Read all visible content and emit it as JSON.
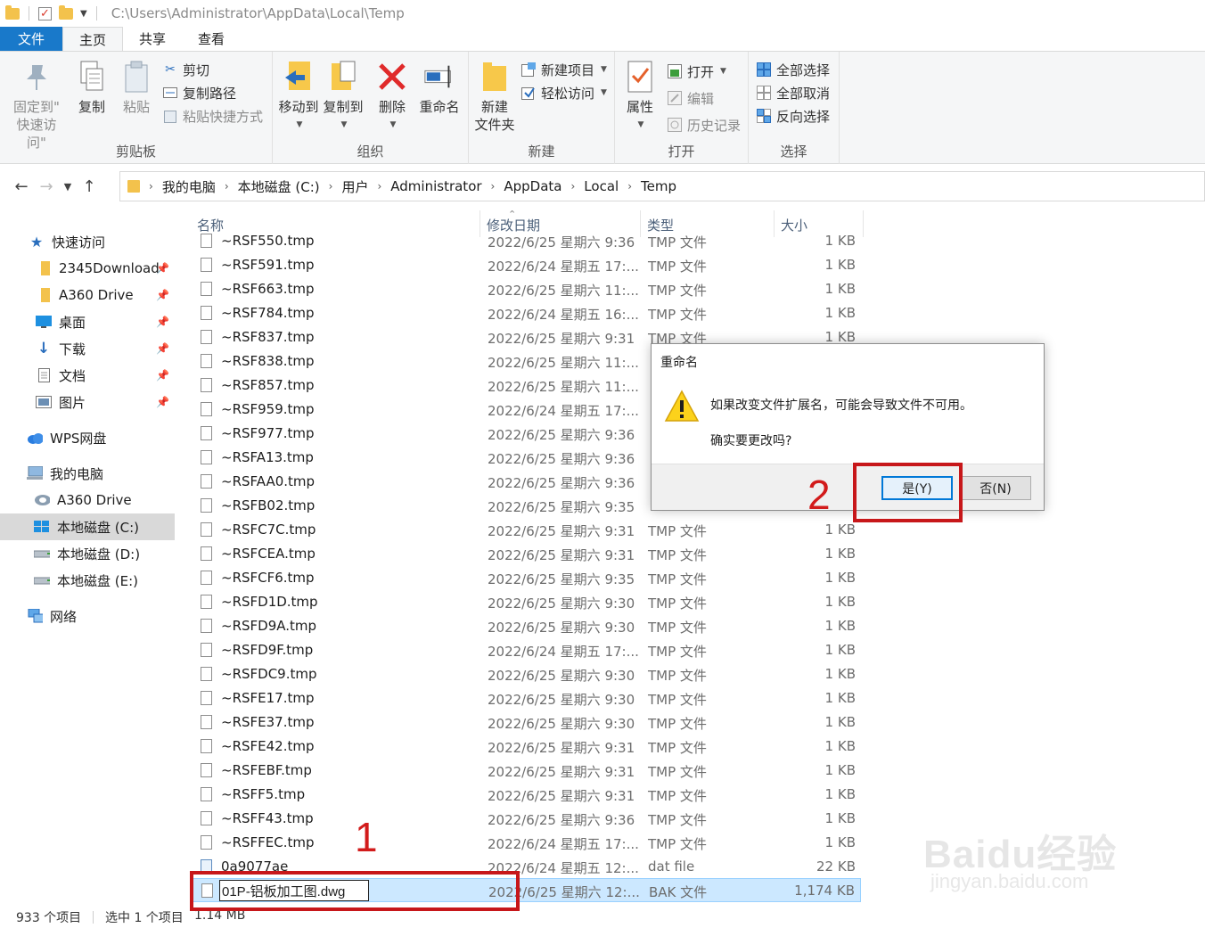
{
  "titlebar": {
    "path": "C:\\Users\\Administrator\\AppData\\Local\\Temp"
  },
  "tabs": [
    {
      "label": "文件"
    },
    {
      "label": "主页"
    },
    {
      "label": "共享"
    },
    {
      "label": "查看"
    }
  ],
  "ribbon": {
    "clipboard": {
      "label": "剪贴板",
      "pin_label_1": "固定到\"",
      "pin_label_2": "快速访问\"",
      "copy": "复制",
      "paste": "粘贴",
      "cut": "剪切",
      "copy_path": "复制路径",
      "paste_shortcut": "粘贴快捷方式"
    },
    "organize": {
      "label": "组织",
      "move_to": "移动到",
      "copy_to": "复制到",
      "delete": "删除",
      "rename": "重命名"
    },
    "new": {
      "label": "新建",
      "new_folder_1": "新建",
      "new_folder_2": "文件夹",
      "new_item": "新建项目",
      "easy_access": "轻松访问"
    },
    "open": {
      "label": "打开",
      "properties": "属性",
      "open": "打开",
      "edit": "编辑",
      "history": "历史记录"
    },
    "select": {
      "label": "选择",
      "select_all": "全部选择",
      "select_none": "全部取消",
      "invert": "反向选择"
    }
  },
  "address": {
    "crumbs": [
      "我的电脑",
      "本地磁盘 (C:)",
      "用户",
      "Administrator",
      "AppData",
      "Local",
      "Temp"
    ]
  },
  "nav": {
    "quick_access": "快速访问",
    "items": [
      {
        "label": "2345Download"
      },
      {
        "label": "A360 Drive"
      },
      {
        "label": "桌面"
      },
      {
        "label": "下载"
      },
      {
        "label": "文档"
      },
      {
        "label": "图片"
      }
    ],
    "wps": "WPS网盘",
    "this_pc": "我的电脑",
    "pc_items": [
      {
        "label": "A360 Drive"
      },
      {
        "label": "本地磁盘 (C:)"
      },
      {
        "label": "本地磁盘 (D:)"
      },
      {
        "label": "本地磁盘 (E:)"
      }
    ],
    "network": "网络"
  },
  "columns": {
    "name": "名称",
    "date": "修改日期",
    "type": "类型",
    "size": "大小"
  },
  "files": [
    {
      "name": "~RSF550.tmp",
      "date": "2022/6/25 星期六 9:36",
      "type": "TMP 文件",
      "size": "1 KB"
    },
    {
      "name": "~RSF591.tmp",
      "date": "2022/6/24 星期五 17:...",
      "type": "TMP 文件",
      "size": "1 KB"
    },
    {
      "name": "~RSF663.tmp",
      "date": "2022/6/25 星期六 11:...",
      "type": "TMP 文件",
      "size": "1 KB"
    },
    {
      "name": "~RSF784.tmp",
      "date": "2022/6/24 星期五 16:...",
      "type": "TMP 文件",
      "size": "1 KB"
    },
    {
      "name": "~RSF837.tmp",
      "date": "2022/6/25 星期六 9:31",
      "type": "TMP 文件",
      "size": "1 KB"
    },
    {
      "name": "~RSF838.tmp",
      "date": "2022/6/25 星期六 11:...",
      "type": "",
      "size": ""
    },
    {
      "name": "~RSF857.tmp",
      "date": "2022/6/25 星期六 11:...",
      "type": "",
      "size": ""
    },
    {
      "name": "~RSF959.tmp",
      "date": "2022/6/24 星期五 17:...",
      "type": "",
      "size": ""
    },
    {
      "name": "~RSF977.tmp",
      "date": "2022/6/25 星期六 9:36",
      "type": "",
      "size": ""
    },
    {
      "name": "~RSFA13.tmp",
      "date": "2022/6/25 星期六 9:36",
      "type": "",
      "size": ""
    },
    {
      "name": "~RSFAA0.tmp",
      "date": "2022/6/25 星期六 9:36",
      "type": "",
      "size": ""
    },
    {
      "name": "~RSFB02.tmp",
      "date": "2022/6/25 星期六 9:35",
      "type": "",
      "size": ""
    },
    {
      "name": "~RSFC7C.tmp",
      "date": "2022/6/25 星期六 9:31",
      "type": "TMP 文件",
      "size": "1 KB"
    },
    {
      "name": "~RSFCEA.tmp",
      "date": "2022/6/25 星期六 9:31",
      "type": "TMP 文件",
      "size": "1 KB"
    },
    {
      "name": "~RSFCF6.tmp",
      "date": "2022/6/25 星期六 9:35",
      "type": "TMP 文件",
      "size": "1 KB"
    },
    {
      "name": "~RSFD1D.tmp",
      "date": "2022/6/25 星期六 9:30",
      "type": "TMP 文件",
      "size": "1 KB"
    },
    {
      "name": "~RSFD9A.tmp",
      "date": "2022/6/25 星期六 9:30",
      "type": "TMP 文件",
      "size": "1 KB"
    },
    {
      "name": "~RSFD9F.tmp",
      "date": "2022/6/24 星期五 17:...",
      "type": "TMP 文件",
      "size": "1 KB"
    },
    {
      "name": "~RSFDC9.tmp",
      "date": "2022/6/25 星期六 9:30",
      "type": "TMP 文件",
      "size": "1 KB"
    },
    {
      "name": "~RSFE17.tmp",
      "date": "2022/6/25 星期六 9:30",
      "type": "TMP 文件",
      "size": "1 KB"
    },
    {
      "name": "~RSFE37.tmp",
      "date": "2022/6/25 星期六 9:30",
      "type": "TMP 文件",
      "size": "1 KB"
    },
    {
      "name": "~RSFE42.tmp",
      "date": "2022/6/25 星期六 9:31",
      "type": "TMP 文件",
      "size": "1 KB"
    },
    {
      "name": "~RSFEBF.tmp",
      "date": "2022/6/25 星期六 9:31",
      "type": "TMP 文件",
      "size": "1 KB"
    },
    {
      "name": "~RSFF5.tmp",
      "date": "2022/6/25 星期六 9:31",
      "type": "TMP 文件",
      "size": "1 KB"
    },
    {
      "name": "~RSFF43.tmp",
      "date": "2022/6/25 星期六 9:36",
      "type": "TMP 文件",
      "size": "1 KB"
    },
    {
      "name": "~RSFFEC.tmp",
      "date": "2022/6/24 星期五 17:...",
      "type": "TMP 文件",
      "size": "1 KB"
    },
    {
      "name": "0a9077ae",
      "date": "2022/6/24 星期五 12:...",
      "type": "dat file",
      "size": "22 KB"
    },
    {
      "name": "01P-铝板加工图.dwg",
      "date": "2022/6/25 星期六 12:...",
      "type": "BAK 文件",
      "size": "1,174 KB"
    }
  ],
  "status": {
    "count": "933 个项目",
    "selected": "选中 1 个项目",
    "size": "1.14 MB"
  },
  "dialog": {
    "title": "重命名",
    "message": "如果改变文件扩展名，可能会导致文件不可用。",
    "question": "确实要更改吗?",
    "yes": "是(Y)",
    "no": "否(N)"
  },
  "annotations": {
    "step1": "1",
    "step2": "2"
  },
  "watermark": {
    "text": "Baidu经验",
    "sub": "jingyan.baidu.com"
  },
  "colors": {
    "accent": "#1979ca",
    "annotation": "#c7171a",
    "selection": "#cce8ff"
  }
}
